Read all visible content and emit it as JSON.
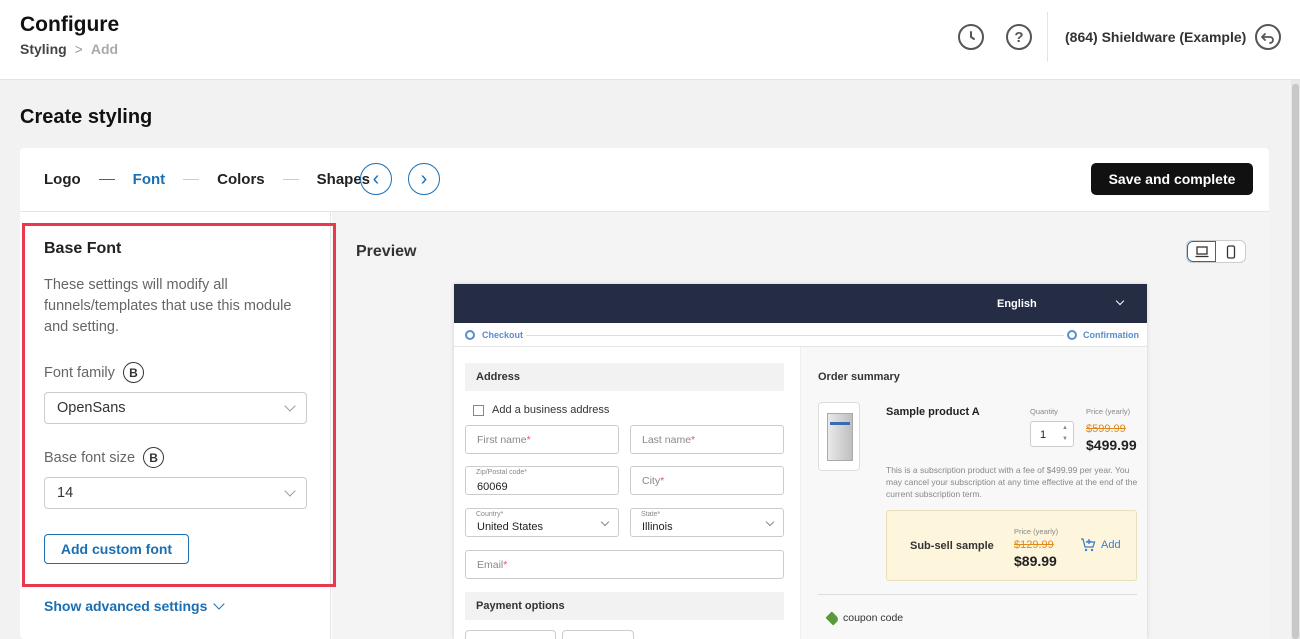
{
  "header": {
    "title": "Configure",
    "breadcrumb": [
      "Styling",
      "Add"
    ],
    "breadcrumb_sep": ">",
    "account_name": "(864) Shieldware (Example)",
    "help_glyph": "?"
  },
  "page": {
    "title": "Create styling"
  },
  "steps": {
    "items": [
      "Logo",
      "Font",
      "Colors",
      "Shapes"
    ],
    "active": "Font",
    "prev_glyph": "‹",
    "next_glyph": "›",
    "save_label": "Save and complete"
  },
  "base_font": {
    "title": "Base Font",
    "description": "These settings will modify all funnels/templates that use this module and setting.",
    "badge": "B",
    "family_label": "Font family",
    "family_value": "OpenSans",
    "size_label": "Base font size",
    "size_value": "14",
    "add_custom_label": "Add custom font",
    "advanced_label": "Show advanced settings"
  },
  "preview": {
    "title": "Preview",
    "language": "English",
    "progress": {
      "start": "Checkout",
      "end": "Confirmation"
    },
    "address": {
      "title": "Address",
      "business_checkbox": "Add a business address",
      "first_name": "First name",
      "last_name": "Last name",
      "zip_label": "Zip/Postal code",
      "zip_value": "60069",
      "city": "City",
      "country_label": "Country",
      "country_value": "United States",
      "state_label": "State",
      "state_value": "Illinois",
      "email": "Email",
      "required_mark": "*"
    },
    "payment_title": "Payment options",
    "order": {
      "title": "Order summary",
      "product_name": "Sample product A",
      "quantity_label": "Quantity",
      "quantity": "1",
      "price_label": "Price (yearly)",
      "old_price": "$599.99",
      "new_price": "$499.99",
      "description": "This is a subscription product with a fee of $499.99 per year. You may cancel your subscription at any time effective at the end of the current subscription term.",
      "upsell": {
        "name": "Sub-sell sample",
        "price_label": "Price (yearly)",
        "old_price": "$129.99",
        "new_price": "$89.99",
        "add_label": "Add"
      },
      "coupon_label": "coupon code"
    }
  },
  "colors": {
    "accent": "#1a6fb3",
    "highlight": "#e8394f",
    "preview_header": "#252d45"
  }
}
